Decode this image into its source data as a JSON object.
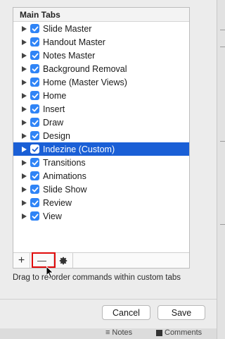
{
  "panel": {
    "header": "Main Tabs",
    "items": [
      {
        "label": "Slide Master",
        "checked": true,
        "selected": false
      },
      {
        "label": "Handout Master",
        "checked": true,
        "selected": false
      },
      {
        "label": "Notes Master",
        "checked": true,
        "selected": false
      },
      {
        "label": "Background Removal",
        "checked": true,
        "selected": false
      },
      {
        "label": "Home (Master Views)",
        "checked": true,
        "selected": false
      },
      {
        "label": "Home",
        "checked": true,
        "selected": false
      },
      {
        "label": "Insert",
        "checked": true,
        "selected": false
      },
      {
        "label": "Draw",
        "checked": true,
        "selected": false
      },
      {
        "label": "Design",
        "checked": true,
        "selected": false
      },
      {
        "label": "Indezine (Custom)",
        "checked": true,
        "selected": true
      },
      {
        "label": "Transitions",
        "checked": true,
        "selected": false
      },
      {
        "label": "Animations",
        "checked": true,
        "selected": false
      },
      {
        "label": "Slide Show",
        "checked": true,
        "selected": false
      },
      {
        "label": "Review",
        "checked": true,
        "selected": false
      },
      {
        "label": "View",
        "checked": true,
        "selected": false
      }
    ],
    "toolbar": {
      "add_label": "+",
      "remove_label": "—",
      "gear_icon": "gear-icon"
    }
  },
  "hint": "Drag to re-order commands within custom tabs",
  "buttons": {
    "cancel": "Cancel",
    "save": "Save"
  },
  "status_bar": {
    "notes": "Notes",
    "comments": "Comments"
  },
  "colors": {
    "selection": "#1a5fd6",
    "checkbox": "#2f84f6",
    "highlight": "#e00b0b"
  }
}
